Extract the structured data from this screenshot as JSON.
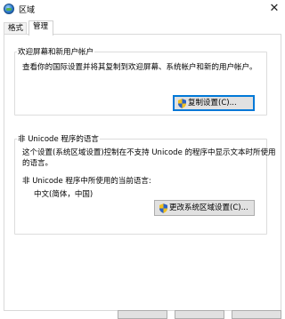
{
  "window": {
    "title": "区域",
    "close_glyph": "✕"
  },
  "tabs": [
    {
      "label": "格式"
    },
    {
      "label": "管理"
    }
  ],
  "welcome": {
    "group_label": "欢迎屏幕和新用户帐户",
    "description": "查看你的国际设置并将其复制到欢迎屏幕、系统帐户和新的用户帐户。",
    "copy_button": "复制设置(C)..."
  },
  "unicode": {
    "group_label": "非 Unicode 程序的语言",
    "description_line1": "这个设置(系统区域设置)控制在不支持 Unicode 的程序中显示文本时所使用",
    "description_line2": "的语言。",
    "current_label": "非 Unicode 程序中所使用的当前语言:",
    "current_value": "中文(简体，中国)",
    "change_button": "更改系统区域设置(C)..."
  },
  "colors": {
    "accent": "#0078d7",
    "button_face": "#e1e1e1",
    "border": "#adadad"
  }
}
